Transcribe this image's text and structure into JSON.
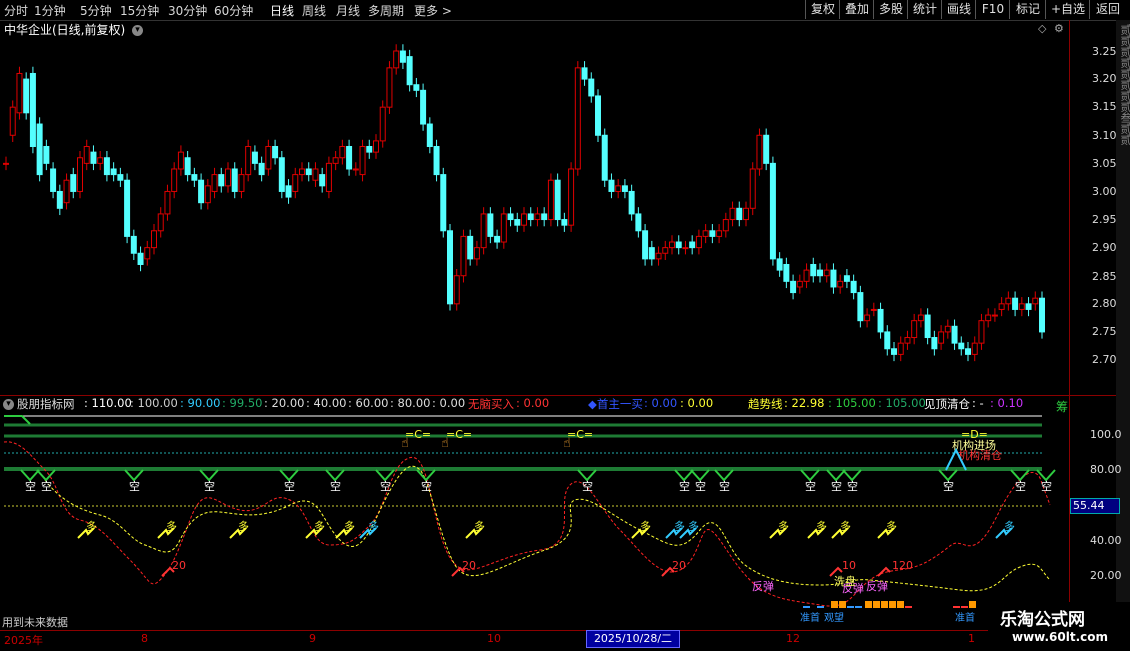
{
  "toolbar": {
    "periods": [
      "分时",
      "1分钟",
      "5分钟",
      "15分钟",
      "30分钟",
      "60分钟",
      "日线",
      "周线",
      "月线",
      "多周期",
      "更多 >"
    ],
    "active_period": "日线",
    "buttons": [
      "复权",
      "叠加",
      "多股",
      "统计",
      "画线",
      "F10",
      "标记",
      "+自选",
      "返回"
    ]
  },
  "stock": {
    "title": "中华企业(日线,前复权)"
  },
  "price_axis": {
    "ticks": [
      "3.25",
      "3.20",
      "3.15",
      "3.10",
      "3.05",
      "3.00",
      "2.95",
      "2.90",
      "2.85",
      "2.80",
      "2.75",
      "2.70"
    ]
  },
  "indicator": {
    "name": "股朋指标网",
    "values": [
      ": 110.00",
      ": 100.00",
      ": 90.00",
      ": 99.50",
      ": 20.00",
      ": 40.00",
      ": 60.00",
      ": 80.00",
      ": 0.00"
    ],
    "buy_label": "无脑买入",
    "buy_value": ": 0.00",
    "main_label": "◆首主一买",
    "main_v1": ": 0.00",
    "main_v2": ": 0.00",
    "trend_label": "趋势线",
    "trend_v1": ": 22.98",
    "trend_v2": ": 105.00",
    "trend_v3": ": 105.00",
    "top_label": "见顶清仓",
    "top_v1": ": -",
    "top_v2": ": 0.10",
    "ticks": [
      "100.0",
      "80.00",
      "60.00",
      "40.00",
      "20.00"
    ],
    "current_value": "55.44",
    "annotations": {
      "kong": "空",
      "duo": "多",
      "c": "=C=",
      "d": "=D=",
      "twenty": "20",
      "ten": "10",
      "twelve": "120",
      "enter": "机构进场",
      "clear": "机构清仓",
      "rebound": "反弹",
      "wash": "洗盘",
      "zhudi": "准首",
      "guanwang": "观望",
      "zhunshou": "准首"
    }
  },
  "date_axis": {
    "labels": [
      "2025年",
      "8",
      "9",
      "10",
      "12",
      "1"
    ],
    "selected": "2025/10/28/二"
  },
  "footer_note": "用到未来数据",
  "right_strip_text": "贰贰贰贰贰贰贰贰叁贰贰",
  "right_strip_text2": "筹",
  "watermark": {
    "line1": "乐淘公式网",
    "line2": "www.60lt.com"
  },
  "colors": {
    "up": "#e00000",
    "down": "#54ffff",
    "axis": "#8b0000",
    "green": "#2e8b3e",
    "yellow": "#ffff33",
    "cyan": "#00ffff"
  },
  "chart_data": {
    "type": "candlestick",
    "open": [
      3.05,
      3.1,
      3.14,
      3.2,
      3.21,
      3.12,
      3.08,
      3.04,
      3.0,
      2.98,
      3.03,
      3.0,
      3.05,
      3.07,
      3.05,
      3.06,
      3.04,
      3.03,
      3.02,
      2.92,
      2.89,
      2.88,
      2.9,
      2.93,
      2.96,
      3.0,
      3.04,
      3.06,
      3.03,
      3.02,
      2.98,
      3.0,
      3.03,
      3.01,
      3.04,
      3.0,
      3.03,
      3.07,
      3.05,
      3.04,
      3.08,
      3.06,
      3.01,
      3.0,
      3.03,
      3.04,
      3.02,
      3.03,
      3.0,
      3.05,
      3.06,
      3.08,
      3.04,
      3.03,
      3.08,
      3.07,
      3.09,
      3.15,
      3.22,
      3.25,
      3.24,
      3.19,
      3.18,
      3.12,
      3.08,
      3.03,
      2.93,
      2.8,
      2.85,
      2.92,
      2.88,
      2.9,
      2.96,
      2.92,
      2.91,
      2.96,
      2.95,
      2.94,
      2.96,
      2.95,
      2.96,
      2.95,
      3.02,
      2.95,
      2.94,
      3.04,
      3.22,
      3.2,
      3.17,
      3.1,
      3.02,
      3.0,
      3.01,
      3.0,
      2.96,
      2.93,
      2.9,
      2.88,
      2.89,
      2.9,
      2.91,
      2.9,
      2.91,
      2.9,
      2.92,
      2.93,
      2.92,
      2.93,
      2.95,
      2.97,
      2.95,
      2.97,
      3.04,
      3.1,
      3.05,
      2.88,
      2.87,
      2.84,
      2.83,
      2.84,
      2.87,
      2.86,
      2.85,
      2.86,
      2.83,
      2.85,
      2.84,
      2.82,
      2.77,
      2.79,
      2.79,
      2.75,
      2.72,
      2.71,
      2.73,
      2.74,
      2.77,
      2.78,
      2.74,
      2.73,
      2.75,
      2.76,
      2.73,
      2.72,
      2.71,
      2.73,
      2.77,
      2.78,
      2.79,
      2.8,
      2.81,
      2.79,
      2.8,
      2.8,
      2.81
    ],
    "close": [
      3.05,
      3.15,
      3.21,
      3.14,
      3.08,
      3.03,
      3.05,
      3.0,
      2.97,
      3.02,
      3.0,
      3.06,
      3.08,
      3.05,
      3.06,
      3.03,
      3.03,
      3.02,
      2.92,
      2.89,
      2.87,
      2.9,
      2.93,
      2.96,
      3.0,
      3.04,
      3.07,
      3.03,
      3.02,
      2.98,
      3.01,
      3.03,
      3.01,
      3.04,
      3.0,
      3.03,
      3.08,
      3.05,
      3.03,
      3.08,
      3.06,
      3.0,
      2.99,
      3.03,
      3.04,
      3.03,
      3.04,
      3.01,
      3.05,
      3.06,
      3.08,
      3.04,
      3.04,
      3.08,
      3.07,
      3.09,
      3.15,
      3.22,
      3.25,
      3.23,
      3.19,
      3.18,
      3.12,
      3.08,
      3.03,
      2.93,
      2.8,
      2.85,
      2.92,
      2.88,
      2.9,
      2.96,
      2.92,
      2.91,
      2.96,
      2.95,
      2.94,
      2.96,
      2.95,
      2.96,
      2.95,
      3.02,
      2.95,
      2.94,
      3.04,
      3.22,
      3.2,
      3.17,
      3.1,
      3.02,
      3.0,
      3.01,
      3.0,
      2.96,
      2.93,
      2.88,
      2.88,
      2.89,
      2.9,
      2.91,
      2.9,
      2.9,
      2.9,
      2.92,
      2.93,
      2.92,
      2.93,
      2.95,
      2.97,
      2.95,
      2.97,
      3.04,
      3.1,
      3.05,
      2.88,
      2.86,
      2.84,
      2.82,
      2.84,
      2.86,
      2.85,
      2.85,
      2.86,
      2.83,
      2.84,
      2.84,
      2.82,
      2.77,
      2.78,
      2.79,
      2.75,
      2.72,
      2.71,
      2.73,
      2.74,
      2.77,
      2.78,
      2.74,
      2.72,
      2.75,
      2.76,
      2.73,
      2.72,
      2.71,
      2.73,
      2.77,
      2.78,
      2.78,
      2.8,
      2.81,
      2.79,
      2.8,
      2.79,
      2.81,
      2.75
    ]
  }
}
